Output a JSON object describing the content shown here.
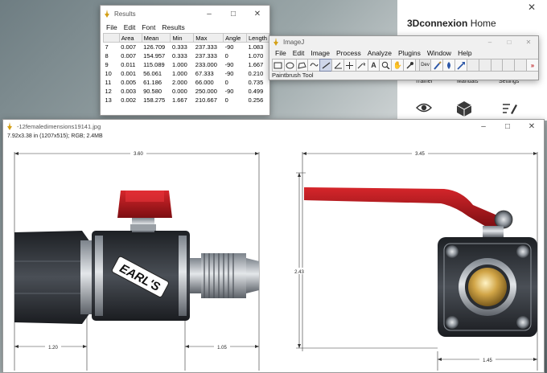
{
  "results": {
    "title": "Results",
    "menu": [
      "File",
      "Edit",
      "Font",
      "Results"
    ],
    "columns": [
      "",
      "Area",
      "Mean",
      "Min",
      "Max",
      "Angle",
      "Length"
    ],
    "rows": [
      [
        "7",
        "0.007",
        "126.709",
        "0.333",
        "237.333",
        "-90",
        "1.083"
      ],
      [
        "8",
        "0.007",
        "154.957",
        "0.333",
        "237.333",
        "0",
        "1.070"
      ],
      [
        "9",
        "0.011",
        "115.089",
        "1.000",
        "233.000",
        "-90",
        "1.667"
      ],
      [
        "10",
        "0.001",
        "56.061",
        "1.000",
        "67.333",
        "-90",
        "0.210"
      ],
      [
        "11",
        "0.005",
        "61.186",
        "2.000",
        "66.000",
        "0",
        "0.735"
      ],
      [
        "12",
        "0.003",
        "90.580",
        "0.000",
        "250.000",
        "-90",
        "0.499"
      ],
      [
        "13",
        "0.002",
        "158.275",
        "1.667",
        "210.667",
        "0",
        "0.256"
      ]
    ]
  },
  "connexion": {
    "title_bold": "3Dconnexion",
    "title_rest": " Home",
    "labels": [
      "Trainer",
      "Manuals",
      "Settings"
    ],
    "icons": [
      "eye-icon",
      "cube-icon",
      "pen-list-icon"
    ]
  },
  "imagej": {
    "title": "ImageJ",
    "menu": [
      "File",
      "Edit",
      "Image",
      "Process",
      "Analyze",
      "Plugins",
      "Window",
      "Help"
    ],
    "tools": [
      "rectangle-tool-icon",
      "oval-tool-icon",
      "polygon-tool-icon",
      "freehand-tool-icon",
      "line-tool-icon",
      "angle-tool-icon",
      "point-tool-icon",
      "wand-tool-icon",
      "text-tool-icon",
      "magnifier-tool-icon",
      "hand-tool-icon",
      "dropper-tool-icon",
      "dev-tool-icon",
      "paintbrush-tool-icon",
      "flood-fill-tool-icon",
      "arrow-tool-icon"
    ],
    "dev_label": "Dev",
    "status": "Paintbrush Tool"
  },
  "image_window": {
    "title": "-12femaledimensions19141.jpg",
    "info": "7.92x3.38 in (1207x515); RGB; 2.4MB",
    "dims": {
      "left_width": "3.60",
      "left_bottom_a": "1.20",
      "left_bottom_b": "1.05",
      "right_width": "3.45",
      "right_height": "2.43",
      "right_bottom": "1.45"
    },
    "brand_text": "EARL'S"
  },
  "colors": {
    "handle_red": "#b5181c",
    "body_dark": "#2b2e33",
    "brass": "#c9a045",
    "accent_red": "#e8222b"
  },
  "window_controls": [
    "minimize-icon",
    "maximize-icon",
    "close-icon"
  ]
}
